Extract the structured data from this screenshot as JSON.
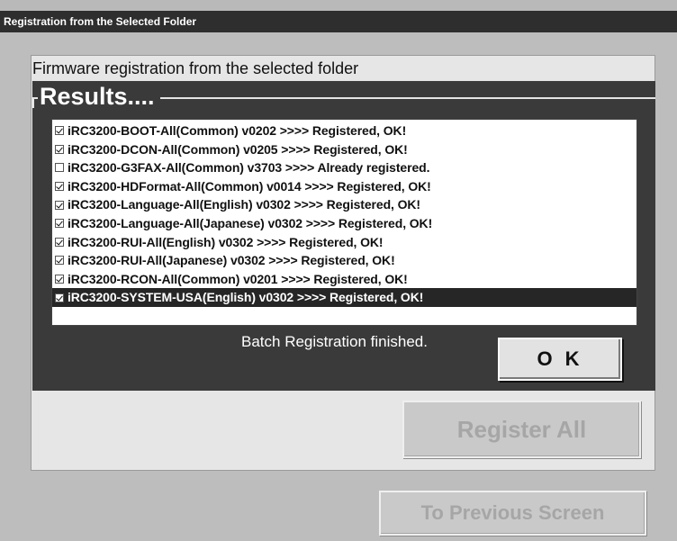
{
  "window": {
    "title": "Registration from the Selected Folder"
  },
  "panel": {
    "heading": "Firmware registration from the selected folder",
    "results_label": "Results...."
  },
  "results": [
    {
      "checked": true,
      "selected": false,
      "text": "iRC3200-BOOT-All(Common) v0202 >>>> Registered, OK!"
    },
    {
      "checked": true,
      "selected": false,
      "text": "iRC3200-DCON-All(Common) v0205 >>>> Registered, OK!"
    },
    {
      "checked": false,
      "selected": false,
      "text": "iRC3200-G3FAX-All(Common) v3703 >>>> Already registered."
    },
    {
      "checked": true,
      "selected": false,
      "text": "iRC3200-HDFormat-All(Common) v0014 >>>> Registered, OK!"
    },
    {
      "checked": true,
      "selected": false,
      "text": "iRC3200-Language-All(English) v0302 >>>> Registered, OK!"
    },
    {
      "checked": true,
      "selected": false,
      "text": "iRC3200-Language-All(Japanese) v0302 >>>> Registered, OK!"
    },
    {
      "checked": true,
      "selected": false,
      "text": "iRC3200-RUI-All(English) v0302 >>>> Registered, OK!"
    },
    {
      "checked": true,
      "selected": false,
      "text": "iRC3200-RUI-All(Japanese) v0302 >>>> Registered, OK!"
    },
    {
      "checked": true,
      "selected": false,
      "text": "iRC3200-RCON-All(Common) v0201 >>>> Registered, OK!"
    },
    {
      "checked": true,
      "selected": true,
      "text": "iRC3200-SYSTEM-USA(English) v0302 >>>> Registered, OK!"
    }
  ],
  "status": {
    "message": "Batch Registration finished."
  },
  "buttons": {
    "ok": "O K",
    "register_all": "Register All",
    "previous_screen": "To Previous Screen"
  }
}
